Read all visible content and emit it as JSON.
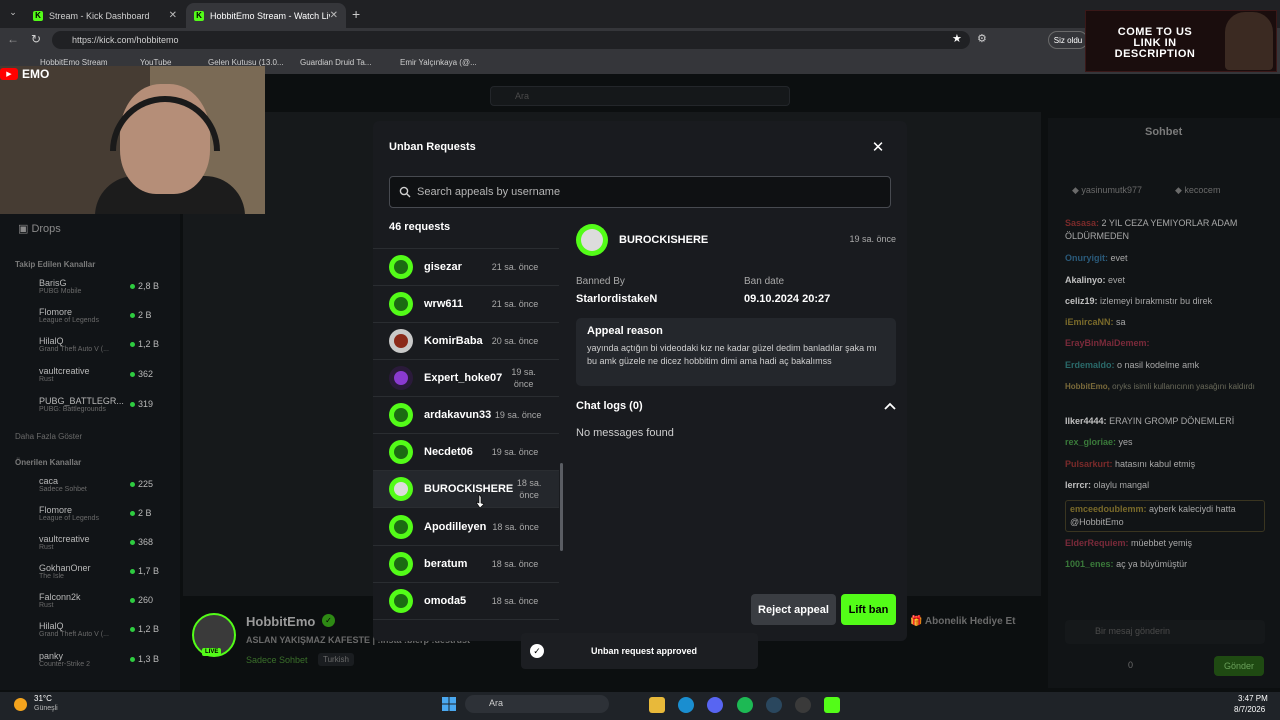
{
  "browser": {
    "tabs": [
      {
        "label": "Stream - Kick Dashboard",
        "active": false
      },
      {
        "label": "HobbitEmo Stream - Watch Live o",
        "active": true
      }
    ],
    "url": "https://kick.com/hobbitemo",
    "bookmarks": [
      "HobbitEmo Stream",
      "YouTube",
      "Gelen Kutusu (13.0...",
      "Guardian Druid Ta...",
      "Emir Yalçınkaya (@..."
    ],
    "profile_label": "Siz oldu"
  },
  "overlay": {
    "webcam_label": "EMO",
    "brand_text": "COME TO US LINK IN DESCRIPTION"
  },
  "page": {
    "search_placeholder": "Ara",
    "drops_label": "Drops",
    "followed_title": "Takip Edilen Kanallar",
    "followed": [
      {
        "name": "BarisG",
        "game": "PUBG Mobile",
        "count": "2,8 B"
      },
      {
        "name": "Flomore",
        "game": "League of Legends",
        "count": "2 B"
      },
      {
        "name": "HilalQ",
        "game": "Grand Theft Auto V (...",
        "count": "1,2 B"
      },
      {
        "name": "vaultcreative",
        "game": "Rust",
        "count": "362"
      },
      {
        "name": "PUBG_BATTLEGR...",
        "game": "PUBG: Battlegrounds",
        "count": "319"
      }
    ],
    "show_more": "Daha Fazla Göster",
    "recommended_title": "Önerilen Kanallar",
    "recommended": [
      {
        "name": "caca",
        "game": "Sadece Sohbet",
        "count": "225"
      },
      {
        "name": "Flomore",
        "game": "League of Legends",
        "count": "2 B"
      },
      {
        "name": "vaultcreative",
        "game": "Rust",
        "count": "368"
      },
      {
        "name": "GokhanOner",
        "game": "The Isle",
        "count": "1,7 B"
      },
      {
        "name": "Falconn2k",
        "game": "Rust",
        "count": "260"
      },
      {
        "name": "HilalQ",
        "game": "Grand Theft Auto V (...",
        "count": "1,2 B"
      },
      {
        "name": "panky",
        "game": "Counter-Strike 2",
        "count": "1,3 B"
      }
    ],
    "streamer_name": "HobbitEmo",
    "stream_title": "ASLAN YAKIŞMAZ KAFESTE | !insta !bierp !destrust",
    "stream_tags": [
      "Sadece Sohbet",
      "Turkish"
    ],
    "live_badge": "LIVE",
    "gift_sub": "Abonelik Hediye Et",
    "chat_title": "Sohbet",
    "chat_pinned": [
      "yasinumutk977",
      "kecocem"
    ],
    "chat_messages": [
      {
        "user": "Sasasa:",
        "text": "2 YIL CEZA YEMIYORLAR ADAM ÖLDÜRMEDEN"
      },
      {
        "user": "Onuryigit:",
        "text": "evet"
      },
      {
        "user": "Akalinyo:",
        "text": "evet"
      },
      {
        "user": "celiz19:",
        "text": "izlemeyi bırakmıstır bu direk"
      },
      {
        "user": "iEmircaNN:",
        "text": "sa"
      },
      {
        "user": "ErayBinMaiDemem:",
        "text": ""
      },
      {
        "user": "Erdemaldo:",
        "text": "o nasil kodelme amk"
      },
      {
        "user": "HobbitEmo,",
        "text": "oryks isimli kullanıcının yasağını kaldırdı"
      },
      {
        "user": "Ilker4444:",
        "text": "ERAYIN GROMP DÖNEMLERİ"
      },
      {
        "user": "rex_gloriae:",
        "text": "yes"
      },
      {
        "user": "Pulsarkurt:",
        "text": "hatasını kabul etmiş"
      },
      {
        "user": "lerrcr:",
        "text": "olaylu mangal"
      },
      {
        "user": "emceedoublemm:",
        "text": "ayberk kaleciydi hatta @HobbitEmo"
      },
      {
        "user": "ElderRequiem:",
        "text": "müebbet yemiş"
      },
      {
        "user": "1001_enes:",
        "text": "aç ya büyümüştür"
      }
    ],
    "chat_placeholder": "Bir mesaj gönderin",
    "chat_send": "Gönder",
    "chat_count": "0"
  },
  "modal": {
    "title": "Unban Requests",
    "search_placeholder": "Search appeals by username",
    "request_count": "46 requests",
    "requests": [
      {
        "username": "gisezar",
        "time": "21 sa. önce",
        "selected": false
      },
      {
        "username": "wrw611",
        "time": "21 sa. önce",
        "selected": false
      },
      {
        "username": "KomirBaba",
        "time": "20 sa. önce",
        "selected": false
      },
      {
        "username": "Expert_hoke07",
        "time": "19 sa. önce",
        "selected": false
      },
      {
        "username": "ardakavun33",
        "time": "19 sa. önce",
        "selected": false
      },
      {
        "username": "Necdet06",
        "time": "19 sa. önce",
        "selected": false
      },
      {
        "username": "BUROCKISHERE",
        "time": "18 sa. önce",
        "selected": true
      },
      {
        "username": "Apodilleyen",
        "time": "18 sa. önce",
        "selected": false
      },
      {
        "username": "beratum",
        "time": "18 sa. önce",
        "selected": false
      },
      {
        "username": "omoda5",
        "time": "18 sa. önce",
        "selected": false
      }
    ],
    "detail": {
      "username": "BUROCKISHERE",
      "time": "19 sa. önce",
      "banned_by_label": "Banned By",
      "banned_by": "StarlordistakeN",
      "ban_date_label": "Ban date",
      "ban_date": "09.10.2024 20:27",
      "appeal_reason_label": "Appeal reason",
      "appeal_reason": "yayında açtığın bi videodaki kız ne kadar güzel dedim banladılar şaka mı bu amk güzele ne dicez hobbitim dimi ama hadi aç bakalımss",
      "chat_logs_label": "Chat logs (0)",
      "no_messages": "No messages found"
    },
    "reject_label": "Reject appeal",
    "lift_label": "Lift ban",
    "toast": "Unban request approved"
  },
  "taskbar": {
    "weather_temp": "31°C",
    "weather_desc": "Güneşli",
    "search_label": "Ara",
    "time": "3:47 PM",
    "date": "8/7/2026"
  },
  "colors": {
    "kick_green": "#53fc18",
    "modal_bg": "#191b1f",
    "page_bg": "#0c0f10"
  }
}
